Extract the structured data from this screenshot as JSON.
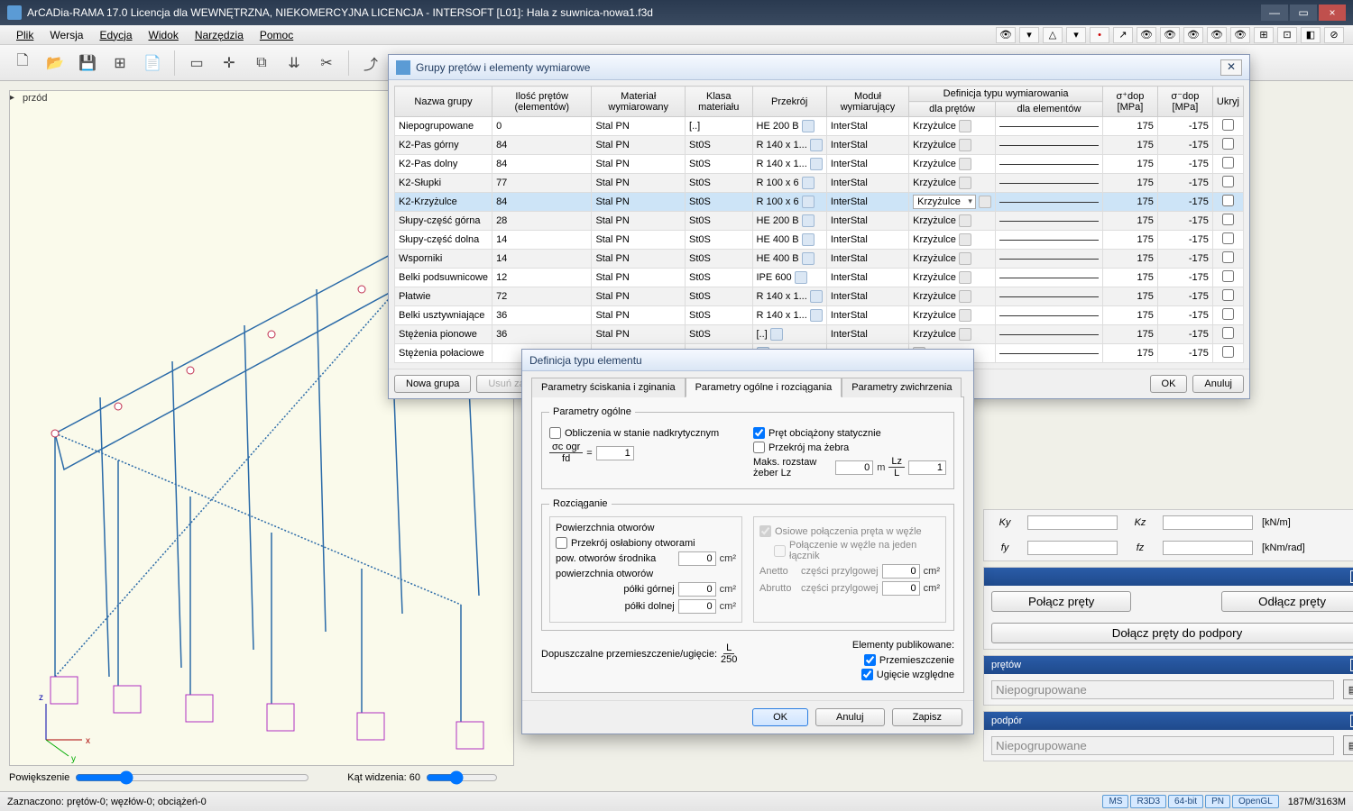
{
  "titlebar": {
    "title": "ArCADia-RAMA 17.0 Licencja dla WEWNĘTRZNA, NIEKOMERCYJNA LICENCJA - INTERSOFT [L01]: Hala z suwnica-nowa1.f3d"
  },
  "menu": {
    "items": [
      "Plik",
      "Wersja",
      "Edycja",
      "Widok",
      "Narzędzia",
      "Pomoc"
    ]
  },
  "view": {
    "label": "przód",
    "zoom_label": "Powiększenie",
    "fov_label": "Kąt widzenia: 60"
  },
  "status": {
    "left": "Zaznaczono: prętów-0; węzłów-0; obciążeń-0",
    "pills": [
      "MS",
      "R3D3",
      "64-bit",
      "PN",
      "OpenGL"
    ],
    "mem": "187M/3163M"
  },
  "groups_dialog": {
    "title": "Grupy prętów i elementy wymiarowe",
    "headers": {
      "name": "Nazwa grupy",
      "count": "Ilość prętów (elementów)",
      "material": "Materiał wymiarowany",
      "class": "Klasa materiału",
      "section": "Przekrój",
      "module": "Moduł wymiarujący",
      "def": "Definicja typu wymiarowania",
      "def_p": "dla prętów",
      "def_e": "dla elementów",
      "sp": "σ⁺dop [MPa]",
      "sm": "σ⁻dop [MPa]",
      "hide": "Ukryj"
    },
    "rows": [
      {
        "n": "Niepogrupowane",
        "c": "0",
        "m": "Stal PN",
        "k": "[..]",
        "s": "HE 200 B",
        "mod": "InterStal",
        "def": "Krzyżulce",
        "sp": "175",
        "sm": "-175",
        "sel": false
      },
      {
        "n": "K2-Pas górny",
        "c": "84",
        "m": "Stal PN",
        "k": "St0S",
        "s": "R 140 x 1...",
        "mod": "InterStal",
        "def": "Krzyżulce",
        "sp": "175",
        "sm": "-175",
        "sel": false
      },
      {
        "n": "K2-Pas dolny",
        "c": "84",
        "m": "Stal PN",
        "k": "St0S",
        "s": "R 140 x 1...",
        "mod": "InterStal",
        "def": "Krzyżulce",
        "sp": "175",
        "sm": "-175",
        "sel": false
      },
      {
        "n": "K2-Słupki",
        "c": "77",
        "m": "Stal PN",
        "k": "St0S",
        "s": "R 100 x 6",
        "mod": "InterStal",
        "def": "Krzyżulce",
        "sp": "175",
        "sm": "-175",
        "sel": false
      },
      {
        "n": "K2-Krzyżulce",
        "c": "84",
        "m": "Stal PN",
        "k": "St0S",
        "s": "R 100 x 6",
        "mod": "InterStal",
        "def": "Krzyżulce",
        "sp": "175",
        "sm": "-175",
        "sel": true
      },
      {
        "n": "Słupy-część górna",
        "c": "28",
        "m": "Stal PN",
        "k": "St0S",
        "s": "HE 200 B",
        "mod": "InterStal",
        "def": "Krzyżulce",
        "sp": "175",
        "sm": "-175",
        "sel": false
      },
      {
        "n": "Słupy-część dolna",
        "c": "14",
        "m": "Stal PN",
        "k": "St0S",
        "s": "HE 400 B",
        "mod": "InterStal",
        "def": "Krzyżulce",
        "sp": "175",
        "sm": "-175",
        "sel": false
      },
      {
        "n": "Wsporniki",
        "c": "14",
        "m": "Stal PN",
        "k": "St0S",
        "s": "HE 400 B",
        "mod": "InterStal",
        "def": "Krzyżulce",
        "sp": "175",
        "sm": "-175",
        "sel": false
      },
      {
        "n": "Belki podsuwnicowe",
        "c": "12",
        "m": "Stal PN",
        "k": "St0S",
        "s": "IPE 600",
        "mod": "InterStal",
        "def": "Krzyżulce",
        "sp": "175",
        "sm": "-175",
        "sel": false
      },
      {
        "n": "Płatwie",
        "c": "72",
        "m": "Stal PN",
        "k": "St0S",
        "s": "R 140 x 1...",
        "mod": "InterStal",
        "def": "Krzyżulce",
        "sp": "175",
        "sm": "-175",
        "sel": false
      },
      {
        "n": "Belki usztywniające",
        "c": "36",
        "m": "Stal PN",
        "k": "St0S",
        "s": "R 140 x 1...",
        "mod": "InterStal",
        "def": "Krzyżulce",
        "sp": "175",
        "sm": "-175",
        "sel": false
      },
      {
        "n": "Stężenia pionowe",
        "c": "36",
        "m": "Stal PN",
        "k": "St0S",
        "s": "[..]",
        "mod": "InterStal",
        "def": "Krzyżulce",
        "sp": "175",
        "sm": "-175",
        "sel": false
      },
      {
        "n": "Stężenia połaciowe",
        "c": "",
        "m": "",
        "k": "",
        "s": "",
        "mod": "",
        "def": "",
        "sp": "175",
        "sm": "-175",
        "sel": false
      }
    ],
    "buttons": {
      "new": "Nowa grupa",
      "del": "Usuń zaz...",
      "ok": "OK",
      "cancel": "Anuluj"
    }
  },
  "def_dialog": {
    "title": "Definicja typu elementu",
    "tabs": [
      "Parametry ściskania i zginania",
      "Parametry ogólne i rozciągania",
      "Parametry zwichrzenia"
    ],
    "general": {
      "legend": "Parametry ogólne",
      "chk_supercrit": "Obliczenia w stanie nadkrytycznym",
      "sigma_eq": "=",
      "sigma_top": "σc ogr",
      "sigma_bot": "fd",
      "sigma_val": "1",
      "chk_static": "Pręt obciążony statycznie",
      "chk_ribs": "Przekrój ma żebra",
      "ribs_label": "Maks. rozstaw żeber  Lz",
      "ribs_val": "0",
      "ribs_unit": "m",
      "ratio_top": "Lz",
      "ratio_bot": "L",
      "ratio_val": "1"
    },
    "tension": {
      "legend": "Rozciąganie",
      "area_legend": "Powierzchnia otworów",
      "chk_weak": "Przekrój osłabiony otworami",
      "lbl1": "pow. otworów środnika",
      "lbl2": "powierzchnia otworów",
      "lbl3": "półki górnej",
      "lbl4": "półki dolnej",
      "unit": "cm²",
      "val": "0",
      "chk_axial": "Osiowe połączenia pręta w węźle",
      "chk_single": "Połączenie w węźle na jeden łącznik",
      "lbl_anetto": "Anetto",
      "lbl_abrutto": "Abrutto",
      "lbl_part": "części przylgowej"
    },
    "disp": {
      "label": "Dopuszczalne przemieszczenie/ugięcie:",
      "top": "L",
      "bot": "250",
      "legend": "Elementy publikowane:",
      "chk1": "Przemieszczenie",
      "chk2": "Ugięcie względne"
    },
    "buttons": {
      "ok": "OK",
      "cancel": "Anuluj",
      "save": "Zapisz"
    }
  },
  "right": {
    "ky": "Ky",
    "kz": "Kz",
    "unit_kn": "[kN/m]",
    "fy": "fy",
    "fz": "fz",
    "unit_knr": "[kNm/rad]",
    "btn_join": "Połącz pręty",
    "btn_split": "Odłącz pręty",
    "btn_support": "Dołącz pręty do podpory",
    "grp_prety": "prętów",
    "grp_podpor": "podpór",
    "combo": "Niepogrupowane"
  }
}
